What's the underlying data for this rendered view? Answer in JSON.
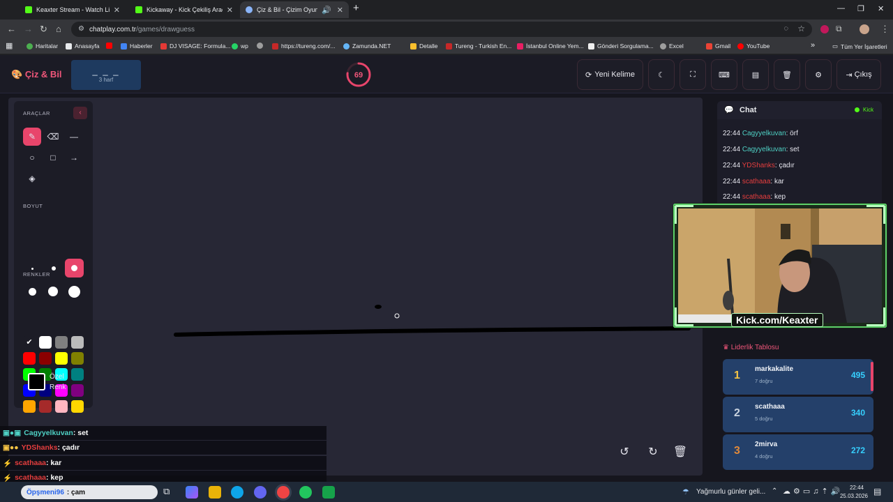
{
  "browser": {
    "tabs": [
      {
        "title": "Keaxter Stream - Watch Live on",
        "favicon_color": "#53fc18",
        "active": false
      },
      {
        "title": "Kickaway - Kick Çekiliş Aracı",
        "favicon_color": "#53fc18",
        "active": false
      },
      {
        "title": "Çiz & Bil - Çizim Oyunu",
        "favicon_color": "#8ab4f8",
        "active": true
      }
    ],
    "url_host": "chatplay.com.tr",
    "url_path": "/games/drawguess",
    "bookmarks": [
      {
        "label": "Haritalar",
        "color": "#4caf50"
      },
      {
        "label": "Anasayfa",
        "color": "#e8eaed"
      },
      {
        "label": "",
        "color": "#ff0000"
      },
      {
        "label": "Haberler",
        "color": "#4285f4"
      },
      {
        "label": "DJ VISAGE: Formula...",
        "color": "#e53935"
      },
      {
        "label": "wp",
        "color": "#25d366"
      },
      {
        "label": "",
        "color": "#9e9e9e"
      },
      {
        "label": "https://tureng.com/...",
        "color": "#c62828"
      },
      {
        "label": "Zamunda.NET",
        "color": "#64b5f6"
      },
      {
        "label": "Detalle",
        "color": "#fbc02d"
      },
      {
        "label": "Tureng - Turkish En...",
        "color": "#c62828"
      },
      {
        "label": "İstanbul Online Yem...",
        "color": "#e91e63"
      },
      {
        "label": "Gönderi Sorgulama...",
        "color": "#eeeeee"
      },
      {
        "label": "Excel",
        "color": "#9e9e9e"
      },
      {
        "label": "Gmail",
        "color": "#ea4335"
      },
      {
        "label": "YouTube",
        "color": "#ff0000"
      }
    ],
    "bookmarks_more": "»",
    "all_bookmarks": "Tüm Yer İşaretleri"
  },
  "app": {
    "brand": "Çiz & Bil",
    "word_mask": "_ _ _",
    "word_hint": "3 harf",
    "timer": "69",
    "timer_fraction": 0.77,
    "header_buttons": {
      "new_word": "Yeni Kelime",
      "logout": "Çıkış"
    }
  },
  "tools": {
    "label_tools": "ARAÇLAR",
    "label_size": "BOYUT",
    "label_colors": "RENKLER",
    "custom_color_line1": "Özel",
    "custom_color_line2": "Renk",
    "colors": [
      "#1c1c26",
      "#ffffff",
      "#808080",
      "#bbbbbb",
      "#ff0000",
      "#8b0000",
      "#ffff00",
      "#808000",
      "#00ff00",
      "#008000",
      "#00ffff",
      "#008080",
      "#0000ff",
      "#000080",
      "#ff00ff",
      "#800080",
      "#ffa500",
      "#a52a2a",
      "#ffb6c1",
      "#ffd700"
    ]
  },
  "chat": {
    "title": "Chat",
    "badge": "Kick",
    "messages": [
      {
        "time": "22:44",
        "user": "Cagyyelkuvan",
        "color": "#4fd1c5",
        "text": ": örf"
      },
      {
        "time": "22:44",
        "user": "Cagyyelkuvan",
        "color": "#4fd1c5",
        "text": ": set"
      },
      {
        "time": "22:44",
        "user": "YDShanks",
        "color": "#e53e3e",
        "text": ": çadır"
      },
      {
        "time": "22:44",
        "user": "scathaaa",
        "color": "#e53e3e",
        "text": ": kar"
      },
      {
        "time": "22:44",
        "user": "scathaaa",
        "color": "#e53e3e",
        "text": ": kep"
      }
    ]
  },
  "webcam": {
    "caption": "Kick.com/Keaxter"
  },
  "leaderboard": {
    "title": "Liderlik Tablosu",
    "rows": [
      {
        "rank": "1",
        "name": "markakalite",
        "sub": "7 doğru",
        "points": "495",
        "rank_color": "#f6c445"
      },
      {
        "rank": "2",
        "name": "scathaaa",
        "sub": "5 doğru",
        "points": "340",
        "rank_color": "#c9d3df"
      },
      {
        "rank": "3",
        "name": "2mirva",
        "sub": "4 doğru",
        "points": "272",
        "rank_color": "#e0893a"
      }
    ]
  },
  "overlay_chat": [
    {
      "user": "Cagyyelkuvan",
      "color": "#4fd1c5",
      "text": " : set"
    },
    {
      "user": "YDShanks",
      "color": "#e53e3e",
      "text": " : çadır"
    },
    {
      "user": "scathaaa",
      "color": "#e53e3e",
      "text": " : kar"
    },
    {
      "user": "scathaaa",
      "color": "#e53e3e",
      "text": " : kep"
    }
  ],
  "taskbar": {
    "search_user": "Öpşmeni96",
    "search_text": ": çam",
    "weather": "Yağmurlu günler geli...",
    "time": "22:44",
    "date": "25.03.2026"
  }
}
